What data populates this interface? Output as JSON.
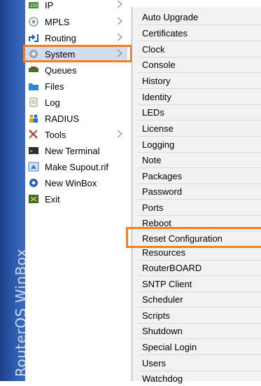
{
  "brand": {
    "text": "RouterOS WinBox"
  },
  "main_menu": {
    "items": [
      {
        "label": "IP",
        "icon": "ip-icon",
        "has_submenu": true
      },
      {
        "label": "MPLS",
        "icon": "mpls-icon",
        "has_submenu": true
      },
      {
        "label": "Routing",
        "icon": "routing-icon",
        "has_submenu": true
      },
      {
        "label": "System",
        "icon": "gear-icon",
        "has_submenu": true,
        "selected": true
      },
      {
        "label": "Queues",
        "icon": "queues-icon",
        "has_submenu": false
      },
      {
        "label": "Files",
        "icon": "folder-icon",
        "has_submenu": false
      },
      {
        "label": "Log",
        "icon": "log-icon",
        "has_submenu": false
      },
      {
        "label": "RADIUS",
        "icon": "users-icon",
        "has_submenu": false
      },
      {
        "label": "Tools",
        "icon": "tools-icon",
        "has_submenu": true
      },
      {
        "label": "New Terminal",
        "icon": "terminal-icon",
        "has_submenu": false
      },
      {
        "label": "Make Supout.rif",
        "icon": "supout-icon",
        "has_submenu": false
      },
      {
        "label": "New WinBox",
        "icon": "winbox-icon",
        "has_submenu": false
      },
      {
        "label": "Exit",
        "icon": "exit-icon",
        "has_submenu": false
      }
    ]
  },
  "system_submenu": {
    "items": [
      "Auto Upgrade",
      "Certificates",
      "Clock",
      "Console",
      "History",
      "Identity",
      "LEDs",
      "License",
      "Logging",
      "Note",
      "Packages",
      "Password",
      "Ports",
      "Reboot",
      "Reset Configuration",
      "Resources",
      "RouterBOARD",
      "SNTP Client",
      "Scheduler",
      "Scripts",
      "Shutdown",
      "Special Login",
      "Users",
      "Watchdog"
    ],
    "highlighted": "Reset Configuration"
  },
  "colors": {
    "highlight_box": "#f07f22",
    "brand_strip": "#2a56a8",
    "selected_row": "#d3dcec"
  }
}
